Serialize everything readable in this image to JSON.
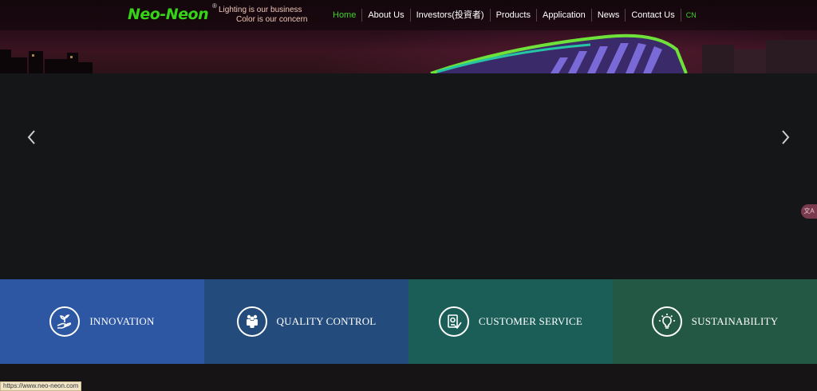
{
  "header": {
    "logo_text": "Neo-Neon",
    "logo_mark": "®",
    "slogan_line1": "Lighting is our business",
    "slogan_line2": "Color is our concern"
  },
  "nav": {
    "items": [
      {
        "label": "Home",
        "active": true
      },
      {
        "label": "About Us"
      },
      {
        "label": "Investors(投資者)"
      },
      {
        "label": "Products"
      },
      {
        "label": "Application"
      },
      {
        "label": "News"
      },
      {
        "label": "Contact Us"
      }
    ],
    "lang": "CN"
  },
  "slider": {
    "prev_icon": "chevron-left-icon",
    "next_icon": "chevron-right-icon",
    "side_badge": "文A"
  },
  "features": [
    {
      "label": "INNOVATION",
      "icon": "hand-plant-icon",
      "color": "#2d56a3"
    },
    {
      "label": "QUALITY CONTROL",
      "icon": "team-icon",
      "color": "#234c7c"
    },
    {
      "label": "CUSTOMER SERVICE",
      "icon": "document-check-icon",
      "color": "#1b5e58"
    },
    {
      "label": "SUSTAINABILITY",
      "icon": "lightbulb-icon",
      "color": "#235845"
    }
  ],
  "status_bar": {
    "url": "https://www.neo-neon.com"
  },
  "colors": {
    "accent": "#3ed22a",
    "background": "#141618"
  }
}
